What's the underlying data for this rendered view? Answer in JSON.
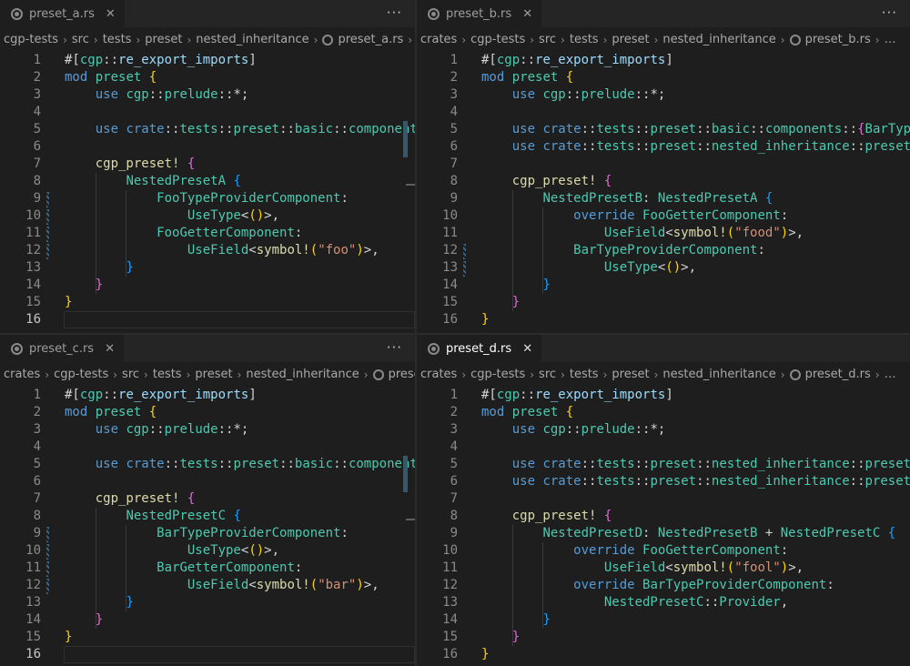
{
  "panes": [
    {
      "tab": "preset_a.rs",
      "active": false,
      "more": "···",
      "crumbs": [
        "cgp-tests",
        "src",
        "tests",
        "preset",
        "nested_inheritance",
        "preset_a.rs",
        "…"
      ]
    },
    {
      "tab": "preset_b.rs",
      "active": false,
      "more": "···",
      "crumbs": [
        "crates",
        "cgp-tests",
        "src",
        "tests",
        "preset",
        "nested_inheritance",
        "preset_b.rs",
        "…"
      ]
    },
    {
      "tab": "preset_c.rs",
      "active": false,
      "more": "···",
      "crumbs": [
        "crates",
        "cgp-tests",
        "src",
        "tests",
        "preset",
        "nested_inheritance",
        "preset"
      ]
    },
    {
      "tab": "preset_d.rs",
      "active": true,
      "more": "",
      "crumbs": [
        "crates",
        "cgp-tests",
        "src",
        "tests",
        "preset",
        "nested_inheritance",
        "preset_d.rs",
        "…"
      ]
    }
  ],
  "code": {
    "a": [
      [
        [
          "p",
          "#["
        ],
        [
          "t",
          "cgp"
        ],
        [
          "p",
          "::"
        ],
        [
          "v",
          "re_export_imports"
        ],
        [
          "p",
          "]"
        ]
      ],
      [
        [
          "k",
          "mod"
        ],
        [
          "p",
          " "
        ],
        [
          "t",
          "preset"
        ],
        [
          "p",
          " "
        ],
        [
          "b1",
          "{"
        ]
      ],
      [
        [
          "p",
          "    "
        ],
        [
          "k",
          "use"
        ],
        [
          "p",
          " "
        ],
        [
          "t",
          "cgp"
        ],
        [
          "p",
          "::"
        ],
        [
          "t",
          "prelude"
        ],
        [
          "p",
          "::*;"
        ]
      ],
      [],
      [
        [
          "p",
          "    "
        ],
        [
          "k",
          "use"
        ],
        [
          "p",
          " "
        ],
        [
          "k",
          "crate"
        ],
        [
          "p",
          "::"
        ],
        [
          "t",
          "tests"
        ],
        [
          "p",
          "::"
        ],
        [
          "t",
          "preset"
        ],
        [
          "p",
          "::"
        ],
        [
          "t",
          "basic"
        ],
        [
          "p",
          "::"
        ],
        [
          "t",
          "components"
        ],
        [
          "p",
          "::"
        ]
      ],
      [],
      [
        [
          "p",
          "    "
        ],
        [
          "f",
          "cgp_preset"
        ],
        [
          "f",
          "!"
        ],
        [
          "p",
          " "
        ],
        [
          "b2",
          "{"
        ]
      ],
      [
        [
          "p",
          "        "
        ],
        [
          "t",
          "NestedPresetA"
        ],
        [
          "p",
          " "
        ],
        [
          "b3",
          "{"
        ]
      ],
      [
        [
          "p",
          "            "
        ],
        [
          "t",
          "FooTypeProviderComponent"
        ],
        [
          "p",
          ":"
        ]
      ],
      [
        [
          "p",
          "                "
        ],
        [
          "t",
          "UseType"
        ],
        [
          "p",
          "<"
        ],
        [
          "b1",
          "()"
        ],
        [
          "p",
          ">,"
        ]
      ],
      [
        [
          "p",
          "            "
        ],
        [
          "t",
          "FooGetterComponent"
        ],
        [
          "p",
          ":"
        ]
      ],
      [
        [
          "p",
          "                "
        ],
        [
          "t",
          "UseField"
        ],
        [
          "p",
          "<"
        ],
        [
          "f",
          "symbol!"
        ],
        [
          "b1",
          "("
        ],
        [
          "s",
          "\"foo\""
        ],
        [
          "b1",
          ")"
        ],
        [
          "p",
          ">,"
        ]
      ],
      [
        [
          "p",
          "        "
        ],
        [
          "b3",
          "}"
        ]
      ],
      [
        [
          "p",
          "    "
        ],
        [
          "b2",
          "}"
        ]
      ],
      [
        [
          "b1",
          "}"
        ]
      ],
      []
    ],
    "b": [
      [
        [
          "p",
          "#["
        ],
        [
          "t",
          "cgp"
        ],
        [
          "p",
          "::"
        ],
        [
          "v",
          "re_export_imports"
        ],
        [
          "p",
          "]"
        ]
      ],
      [
        [
          "k",
          "mod"
        ],
        [
          "p",
          " "
        ],
        [
          "t",
          "preset"
        ],
        [
          "p",
          " "
        ],
        [
          "b1",
          "{"
        ]
      ],
      [
        [
          "p",
          "    "
        ],
        [
          "k",
          "use"
        ],
        [
          "p",
          " "
        ],
        [
          "t",
          "cgp"
        ],
        [
          "p",
          "::"
        ],
        [
          "t",
          "prelude"
        ],
        [
          "p",
          "::*;"
        ]
      ],
      [],
      [
        [
          "p",
          "    "
        ],
        [
          "k",
          "use"
        ],
        [
          "p",
          " "
        ],
        [
          "k",
          "crate"
        ],
        [
          "p",
          "::"
        ],
        [
          "t",
          "tests"
        ],
        [
          "p",
          "::"
        ],
        [
          "t",
          "preset"
        ],
        [
          "p",
          "::"
        ],
        [
          "t",
          "basic"
        ],
        [
          "p",
          "::"
        ],
        [
          "t",
          "components"
        ],
        [
          "p",
          "::"
        ],
        [
          "b2",
          "{"
        ],
        [
          "t",
          "BarTypeProviderComponent"
        ]
      ],
      [
        [
          "p",
          "    "
        ],
        [
          "k",
          "use"
        ],
        [
          "p",
          " "
        ],
        [
          "k",
          "crate"
        ],
        [
          "p",
          "::"
        ],
        [
          "t",
          "tests"
        ],
        [
          "p",
          "::"
        ],
        [
          "t",
          "preset"
        ],
        [
          "p",
          "::"
        ],
        [
          "t",
          "nested_inheritance"
        ],
        [
          "p",
          "::"
        ],
        [
          "t",
          "preset_a"
        ]
      ],
      [],
      [
        [
          "p",
          "    "
        ],
        [
          "f",
          "cgp_preset"
        ],
        [
          "f",
          "!"
        ],
        [
          "p",
          " "
        ],
        [
          "b2",
          "{"
        ]
      ],
      [
        [
          "p",
          "        "
        ],
        [
          "t",
          "NestedPresetB"
        ],
        [
          "p",
          ": "
        ],
        [
          "t",
          "NestedPresetA"
        ],
        [
          "p",
          " "
        ],
        [
          "b3",
          "{"
        ]
      ],
      [
        [
          "p",
          "            "
        ],
        [
          "k",
          "override"
        ],
        [
          "p",
          " "
        ],
        [
          "t",
          "FooGetterComponent"
        ],
        [
          "p",
          ":"
        ]
      ],
      [
        [
          "p",
          "                "
        ],
        [
          "t",
          "UseField"
        ],
        [
          "p",
          "<"
        ],
        [
          "f",
          "symbol!"
        ],
        [
          "b1",
          "("
        ],
        [
          "s",
          "\"food\""
        ],
        [
          "b1",
          ")"
        ],
        [
          "p",
          ">,"
        ]
      ],
      [
        [
          "p",
          "            "
        ],
        [
          "t",
          "BarTypeProviderComponent"
        ],
        [
          "p",
          ":"
        ]
      ],
      [
        [
          "p",
          "                "
        ],
        [
          "t",
          "UseType"
        ],
        [
          "p",
          "<"
        ],
        [
          "b1",
          "()"
        ],
        [
          "p",
          ">,"
        ]
      ],
      [
        [
          "p",
          "        "
        ],
        [
          "b3",
          "}"
        ]
      ],
      [
        [
          "p",
          "    "
        ],
        [
          "b2",
          "}"
        ]
      ],
      [
        [
          "b1",
          "}"
        ]
      ]
    ],
    "c": [
      [
        [
          "p",
          "#["
        ],
        [
          "t",
          "cgp"
        ],
        [
          "p",
          "::"
        ],
        [
          "v",
          "re_export_imports"
        ],
        [
          "p",
          "]"
        ]
      ],
      [
        [
          "k",
          "mod"
        ],
        [
          "p",
          " "
        ],
        [
          "t",
          "preset"
        ],
        [
          "p",
          " "
        ],
        [
          "b1",
          "{"
        ]
      ],
      [
        [
          "p",
          "    "
        ],
        [
          "k",
          "use"
        ],
        [
          "p",
          " "
        ],
        [
          "t",
          "cgp"
        ],
        [
          "p",
          "::"
        ],
        [
          "t",
          "prelude"
        ],
        [
          "p",
          "::*;"
        ]
      ],
      [],
      [
        [
          "p",
          "    "
        ],
        [
          "k",
          "use"
        ],
        [
          "p",
          " "
        ],
        [
          "k",
          "crate"
        ],
        [
          "p",
          "::"
        ],
        [
          "t",
          "tests"
        ],
        [
          "p",
          "::"
        ],
        [
          "t",
          "preset"
        ],
        [
          "p",
          "::"
        ],
        [
          "t",
          "basic"
        ],
        [
          "p",
          "::"
        ],
        [
          "t",
          "components"
        ],
        [
          "p",
          "::"
        ]
      ],
      [],
      [
        [
          "p",
          "    "
        ],
        [
          "f",
          "cgp_preset"
        ],
        [
          "f",
          "!"
        ],
        [
          "p",
          " "
        ],
        [
          "b2",
          "{"
        ]
      ],
      [
        [
          "p",
          "        "
        ],
        [
          "t",
          "NestedPresetC"
        ],
        [
          "p",
          " "
        ],
        [
          "b3",
          "{"
        ]
      ],
      [
        [
          "p",
          "            "
        ],
        [
          "t",
          "BarTypeProviderComponent"
        ],
        [
          "p",
          ":"
        ]
      ],
      [
        [
          "p",
          "                "
        ],
        [
          "t",
          "UseType"
        ],
        [
          "p",
          "<"
        ],
        [
          "b1",
          "()"
        ],
        [
          "p",
          ">,"
        ]
      ],
      [
        [
          "p",
          "            "
        ],
        [
          "t",
          "BarGetterComponent"
        ],
        [
          "p",
          ":"
        ]
      ],
      [
        [
          "p",
          "                "
        ],
        [
          "t",
          "UseField"
        ],
        [
          "p",
          "<"
        ],
        [
          "f",
          "symbol!"
        ],
        [
          "b1",
          "("
        ],
        [
          "s",
          "\"bar\""
        ],
        [
          "b1",
          ")"
        ],
        [
          "p",
          ">,"
        ]
      ],
      [
        [
          "p",
          "        "
        ],
        [
          "b3",
          "}"
        ]
      ],
      [
        [
          "p",
          "    "
        ],
        [
          "b2",
          "}"
        ]
      ],
      [
        [
          "b1",
          "}"
        ]
      ],
      []
    ],
    "d": [
      [
        [
          "p",
          "#["
        ],
        [
          "t",
          "cgp"
        ],
        [
          "p",
          "::"
        ],
        [
          "v",
          "re_export_imports"
        ],
        [
          "p",
          "]"
        ]
      ],
      [
        [
          "k",
          "mod"
        ],
        [
          "p",
          " "
        ],
        [
          "t",
          "preset"
        ],
        [
          "p",
          " "
        ],
        [
          "b1",
          "{"
        ]
      ],
      [
        [
          "p",
          "    "
        ],
        [
          "k",
          "use"
        ],
        [
          "p",
          " "
        ],
        [
          "t",
          "cgp"
        ],
        [
          "p",
          "::"
        ],
        [
          "t",
          "prelude"
        ],
        [
          "p",
          "::*;"
        ]
      ],
      [],
      [
        [
          "p",
          "    "
        ],
        [
          "k",
          "use"
        ],
        [
          "p",
          " "
        ],
        [
          "k",
          "crate"
        ],
        [
          "p",
          "::"
        ],
        [
          "t",
          "tests"
        ],
        [
          "p",
          "::"
        ],
        [
          "t",
          "preset"
        ],
        [
          "p",
          "::"
        ],
        [
          "t",
          "nested_inheritance"
        ],
        [
          "p",
          "::"
        ],
        [
          "t",
          "preset_b"
        ]
      ],
      [
        [
          "p",
          "    "
        ],
        [
          "k",
          "use"
        ],
        [
          "p",
          " "
        ],
        [
          "k",
          "crate"
        ],
        [
          "p",
          "::"
        ],
        [
          "t",
          "tests"
        ],
        [
          "p",
          "::"
        ],
        [
          "t",
          "preset"
        ],
        [
          "p",
          "::"
        ],
        [
          "t",
          "nested_inheritance"
        ],
        [
          "p",
          "::"
        ],
        [
          "t",
          "preset_c"
        ]
      ],
      [],
      [
        [
          "p",
          "    "
        ],
        [
          "f",
          "cgp_preset"
        ],
        [
          "f",
          "!"
        ],
        [
          "p",
          " "
        ],
        [
          "b2",
          "{"
        ]
      ],
      [
        [
          "p",
          "        "
        ],
        [
          "t",
          "NestedPresetD"
        ],
        [
          "p",
          ": "
        ],
        [
          "t",
          "NestedPresetB"
        ],
        [
          "p",
          " + "
        ],
        [
          "t",
          "NestedPresetC"
        ],
        [
          "p",
          " "
        ],
        [
          "b3",
          "{"
        ]
      ],
      [
        [
          "p",
          "            "
        ],
        [
          "k",
          "override"
        ],
        [
          "p",
          " "
        ],
        [
          "t",
          "FooGetterComponent"
        ],
        [
          "p",
          ":"
        ]
      ],
      [
        [
          "p",
          "                "
        ],
        [
          "t",
          "UseField"
        ],
        [
          "p",
          "<"
        ],
        [
          "f",
          "symbol!"
        ],
        [
          "b1",
          "("
        ],
        [
          "s",
          "\"fool\""
        ],
        [
          "b1",
          ")"
        ],
        [
          "p",
          ">,"
        ]
      ],
      [
        [
          "p",
          "            "
        ],
        [
          "k",
          "override"
        ],
        [
          "p",
          " "
        ],
        [
          "t",
          "BarTypeProviderComponent"
        ],
        [
          "p",
          ":"
        ]
      ],
      [
        [
          "p",
          "                "
        ],
        [
          "t",
          "NestedPresetC"
        ],
        [
          "p",
          "::"
        ],
        [
          "t",
          "Provider"
        ],
        [
          "p",
          ","
        ]
      ],
      [
        [
          "p",
          "        "
        ],
        [
          "b3",
          "}"
        ]
      ],
      [
        [
          "p",
          "    "
        ],
        [
          "b2",
          "}"
        ]
      ],
      [
        [
          "b1",
          "}"
        ]
      ]
    ]
  }
}
